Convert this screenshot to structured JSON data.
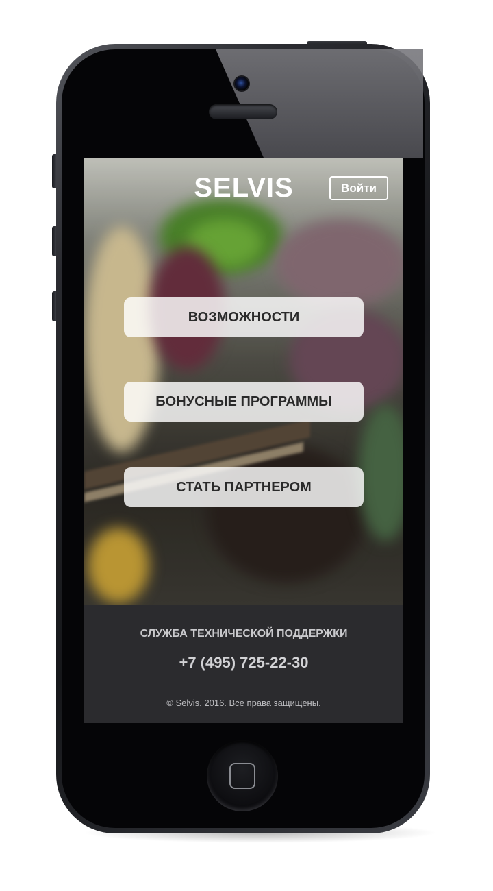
{
  "header": {
    "brand": "SELVIS",
    "login_label": "Войти"
  },
  "menu": {
    "items": [
      {
        "label": "ВОЗМОЖНОСТИ"
      },
      {
        "label": "БОНУСНЫЕ ПРОГРАММЫ"
      },
      {
        "label": "СТАТЬ ПАРТНЕРОМ"
      }
    ]
  },
  "footer": {
    "support_label": "СЛУЖБА ТЕХНИЧЕСКОЙ ПОДДЕРЖКИ",
    "phone": "+7 (495) 725-22-30",
    "copyright": "© Selvis. 2016. Все права защищены."
  },
  "icons": {
    "camera": "camera-icon",
    "speaker": "speaker-icon",
    "home": "home-button-icon"
  },
  "colors": {
    "footer_bg": "#2b2b2e",
    "button_bg": "rgba(255,255,255,0.82)",
    "text_light": "#ffffff"
  }
}
